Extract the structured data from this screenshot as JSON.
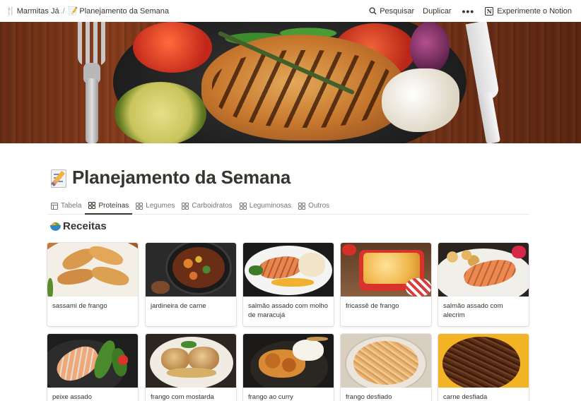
{
  "topbar": {
    "breadcrumb": [
      {
        "icon": "fork-knife-icon",
        "emoji": "🍴",
        "label": "Marmitas Já"
      },
      {
        "icon": "memo-icon",
        "emoji": "📝",
        "label": "Planejamento da Semana"
      }
    ],
    "separator": "/",
    "search_label": "Pesquisar",
    "duplicate_label": "Duplicar",
    "more_label": "•••",
    "notion_cta": "Experimente o Notion"
  },
  "page": {
    "title": "Planejamento da Semana",
    "title_icon": "memo-icon"
  },
  "tabs": [
    {
      "label": "Tabela",
      "icon": "table-icon",
      "active": false
    },
    {
      "label": "Proteínas",
      "icon": "gallery-icon",
      "active": true
    },
    {
      "label": "Legumes",
      "icon": "gallery-icon",
      "active": false
    },
    {
      "label": "Carboidratos",
      "icon": "gallery-icon",
      "active": false
    },
    {
      "label": "Leguminosas",
      "icon": "gallery-icon",
      "active": false
    },
    {
      "label": "Outros",
      "icon": "gallery-icon",
      "active": false
    }
  ],
  "section": {
    "title": "Receitas",
    "icon": "bowl-icon"
  },
  "cards": [
    {
      "label": "sassami de frango"
    },
    {
      "label": "jardineira de carne"
    },
    {
      "label": "salmão assado com molho de maracujá"
    },
    {
      "label": "fricassê de frango"
    },
    {
      "label": "salmão assado com alecrim"
    },
    {
      "label": "peixe assado"
    },
    {
      "label": "frango com mostarda"
    },
    {
      "label": "frango ao curry"
    },
    {
      "label": "frango desfiado"
    },
    {
      "label": "carne desfiada"
    }
  ],
  "colors": {
    "text": "#37352f",
    "muted": "#787774",
    "border": "#e9e9e7"
  }
}
